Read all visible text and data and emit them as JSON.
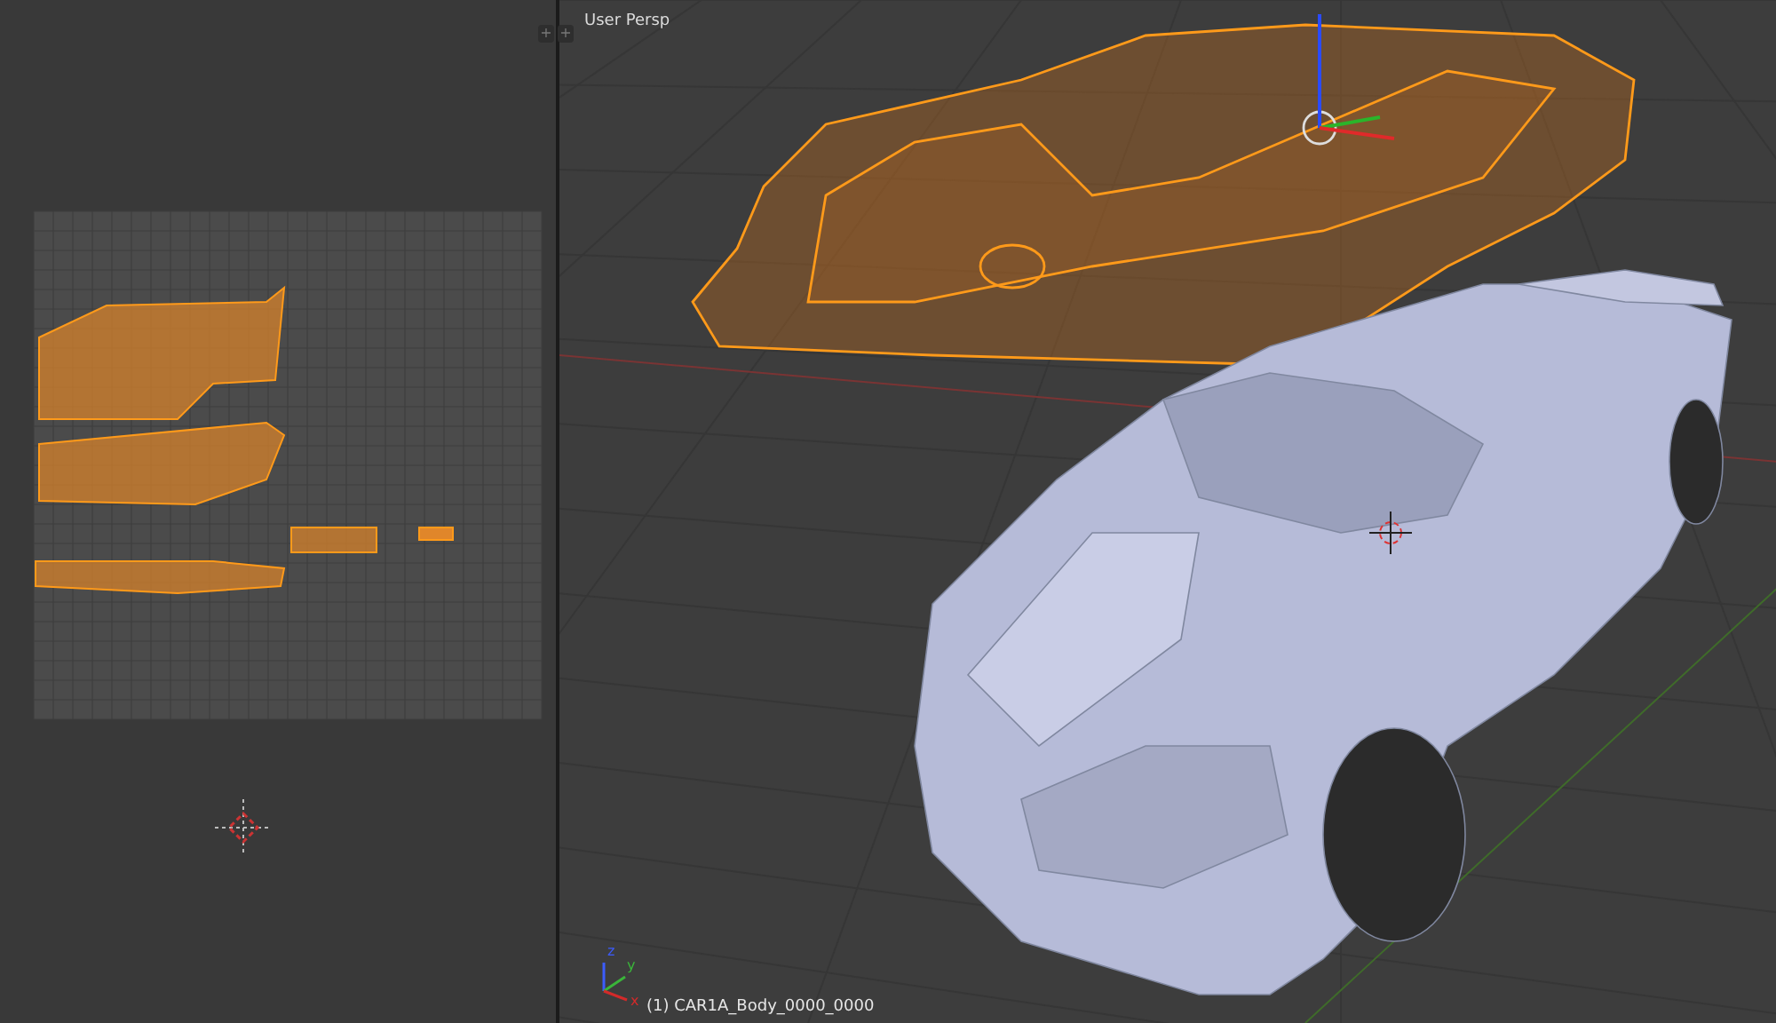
{
  "uv_editor": {
    "area_buttons": [
      "+",
      "+"
    ]
  },
  "viewport": {
    "view_label": "User Persp",
    "object_label": "(1) CAR1A_Body_0000_0000",
    "axis_labels": {
      "x": "x",
      "y": "y",
      "z": "z"
    }
  }
}
